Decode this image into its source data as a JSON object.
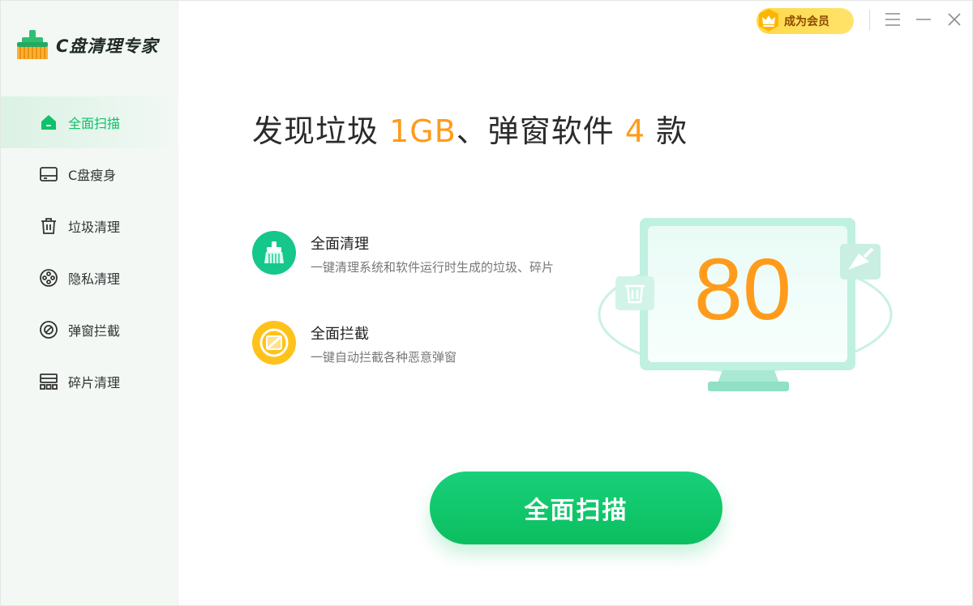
{
  "app": {
    "title": "C盘清理专家"
  },
  "sidebar": {
    "items": [
      {
        "label": "全面扫描",
        "icon": "home-icon",
        "active": true
      },
      {
        "label": "C盘瘦身",
        "icon": "disk-icon",
        "active": false
      },
      {
        "label": "垃圾清理",
        "icon": "trash-icon",
        "active": false
      },
      {
        "label": "隐私清理",
        "icon": "privacy-icon",
        "active": false
      },
      {
        "label": "弹窗拦截",
        "icon": "block-icon",
        "active": false
      },
      {
        "label": "碎片清理",
        "icon": "fragment-icon",
        "active": false
      }
    ]
  },
  "header": {
    "vip_label": "成为会员"
  },
  "main": {
    "headline": {
      "part1": "发现垃圾 ",
      "junk_size": "1GB",
      "part2": "、弹窗软件 ",
      "popup_count": "4",
      "part3": " 款"
    },
    "features": [
      {
        "title": "全面清理",
        "desc": "一键清理系统和软件运行时生成的垃圾、碎片",
        "icon": "broom-icon"
      },
      {
        "title": "全面拦截",
        "desc": "一键自动拦截各种恶意弹窗",
        "icon": "shield-block-icon"
      }
    ],
    "score": "80",
    "scan_button_label": "全面扫描"
  },
  "colors": {
    "accent_green": "#0ec16a",
    "accent_orange": "#ff9b1c",
    "vip_yellow": "#ffd84a"
  }
}
